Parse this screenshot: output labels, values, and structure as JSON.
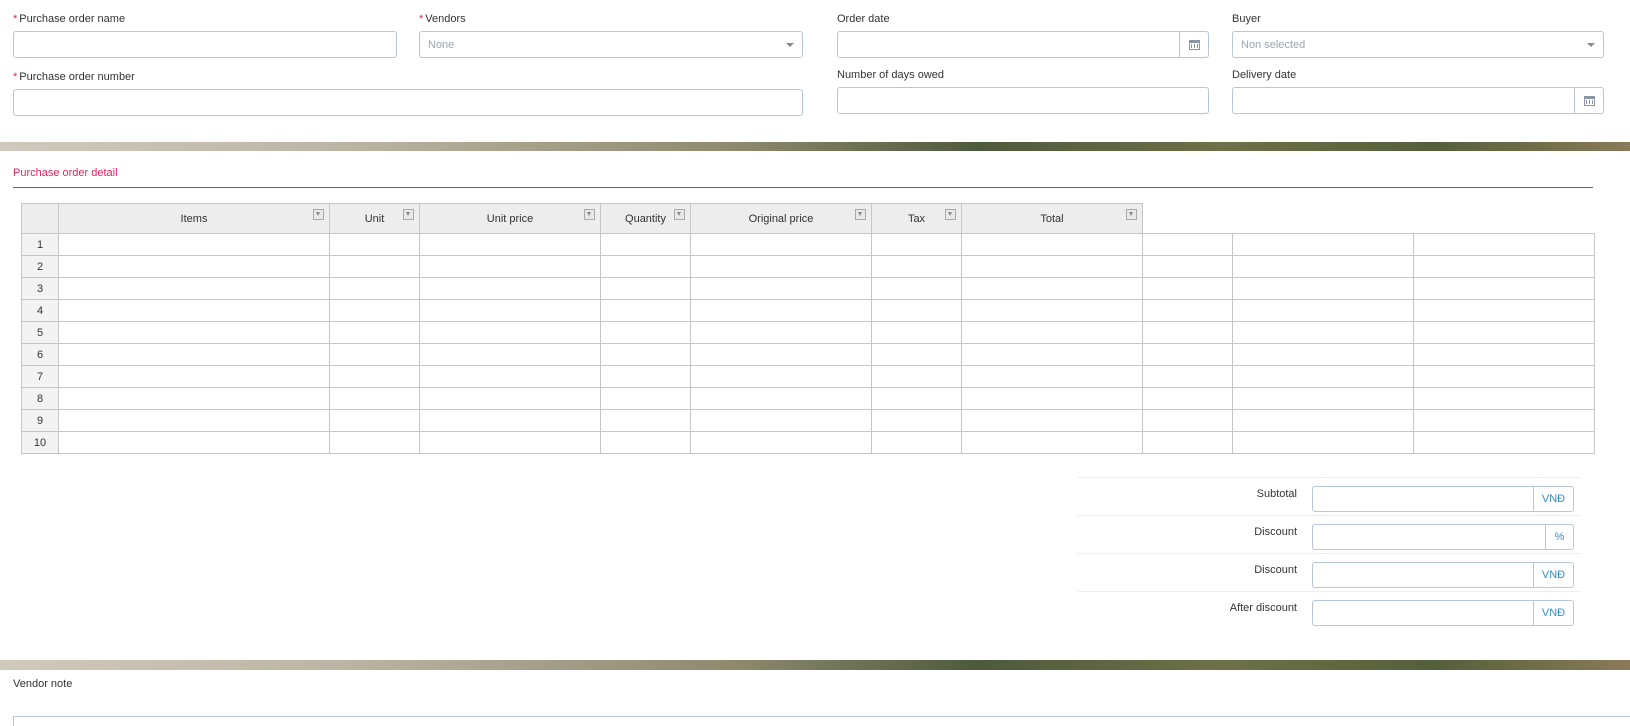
{
  "form": {
    "purchase_order_name": {
      "label": "Purchase order name",
      "required": "*",
      "value": ""
    },
    "vendors": {
      "label": "Vendors",
      "required": "*",
      "value": "None"
    },
    "order_date": {
      "label": "Order date",
      "value": ""
    },
    "buyer": {
      "label": "Buyer",
      "value": "Non selected"
    },
    "purchase_order_number": {
      "label": "Purchase order number",
      "required": "*",
      "value": ""
    },
    "days_owed": {
      "label": "Number of days owed",
      "value": ""
    },
    "delivery_date": {
      "label": "Delivery date",
      "value": ""
    }
  },
  "detail": {
    "title": "Purchase order detail",
    "columns": [
      "Items",
      "Unit",
      "Unit price",
      "Quantity",
      "Original price",
      "Tax",
      "Total"
    ],
    "rows": [
      "1",
      "2",
      "3",
      "4",
      "5",
      "6",
      "7",
      "8",
      "9",
      "10"
    ]
  },
  "summary": {
    "subtotal": {
      "label": "Subtotal",
      "unit": "VNĐ"
    },
    "discount_pct": {
      "label": "Discount",
      "unit": "%"
    },
    "discount_amt": {
      "label": "Discount",
      "unit": "VNĐ"
    },
    "after_discount": {
      "label": "After discount",
      "unit": "VNĐ"
    }
  },
  "vendor_note": {
    "label": "Vendor note"
  },
  "colors": {
    "accent": "#e0245e",
    "link": "#2f8fd0",
    "border": "#b9c6d6"
  },
  "icons": [
    "calendar-icon",
    "chevron-down-icon",
    "filter-icon"
  ]
}
